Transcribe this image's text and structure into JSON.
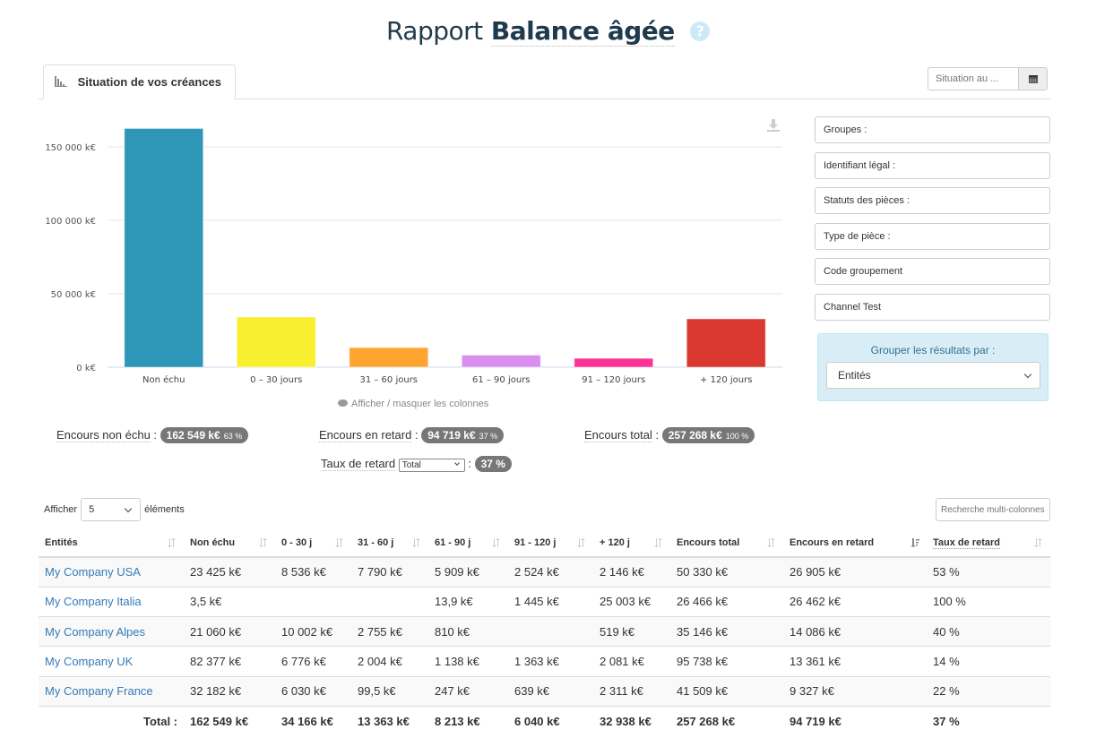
{
  "header": {
    "title_light": "Rapport",
    "title_bold": "Balance âgée",
    "help_icon": "question-circle-icon"
  },
  "tabs": [
    {
      "label": "Situation de vos créances",
      "icon": "bar-chart-icon",
      "active": true
    }
  ],
  "date_filter": {
    "placeholder": "Situation au ...",
    "icon": "calendar-icon"
  },
  "chart_data": {
    "type": "bar",
    "title": "",
    "xlabel": "",
    "ylabel": "",
    "categories": [
      "Non échu",
      "0 – 30 jours",
      "31 – 60 jours",
      "61 – 90 jours",
      "91 – 120 jours",
      "+ 120 jours"
    ],
    "values": [
      162549,
      34166,
      13363,
      8213,
      6040,
      32938
    ],
    "colors": [
      "#2e97b8",
      "#f7ef30",
      "#fda431",
      "#d88ff0",
      "#fd3296",
      "#da3830"
    ],
    "ylim": [
      0,
      165000
    ],
    "yticks": [
      0,
      50000,
      100000,
      150000
    ],
    "ytick_labels": [
      "0 k€",
      "50 000 k€",
      "100 000 k€",
      "150 000 k€"
    ],
    "grid": true,
    "unit": "k€"
  },
  "chart_footer": {
    "toggle_columns": "Afficher / masquer les colonnes",
    "icon": "eye-icon"
  },
  "download_icon": "download-icon",
  "filters": [
    {
      "label": "Groupes :"
    },
    {
      "label": "Identifiant légal :"
    },
    {
      "label": "Statuts des pièces :"
    },
    {
      "label": "Type de pièce :"
    },
    {
      "label": "Code groupement"
    },
    {
      "label": "Channel Test"
    }
  ],
  "group_by": {
    "label": "Grouper les résultats par :",
    "selected": "Entités"
  },
  "summary": {
    "non_echu": {
      "label": "Encours non échu",
      "value": "162 549 k€",
      "pct": "63 %"
    },
    "retard": {
      "label": "Encours en retard",
      "value": "94 719 k€",
      "pct": "37 %"
    },
    "total": {
      "label": "Encours total",
      "value": "257 268 k€",
      "pct": "100 %"
    },
    "taux": {
      "label": "Taux de retard",
      "select": "Total",
      "value": "37 %"
    }
  },
  "table_controls": {
    "show_label": "Afficher",
    "page_length": "5",
    "elements_label": "éléments",
    "search_placeholder": "Recherche multi-colonnes"
  },
  "table": {
    "columns": [
      "Entités",
      "Non échu",
      "0 - 30 j",
      "31 - 60 j",
      "61 - 90 j",
      "91 - 120 j",
      "+ 120 j",
      "Encours total",
      "Encours en retard",
      "Taux de retard"
    ],
    "sorted_column": "Encours en retard",
    "rows": [
      [
        "My Company USA",
        "23 425 k€",
        "8 536 k€",
        "7 790 k€",
        "5 909 k€",
        "2 524 k€",
        "2 146 k€",
        "50 330 k€",
        "26 905 k€",
        "53 %"
      ],
      [
        "My Company Italia",
        "3,5 k€",
        "",
        "",
        "13,9 k€",
        "1 445 k€",
        "25 003 k€",
        "26 466 k€",
        "26 462 k€",
        "100 %"
      ],
      [
        "My Company Alpes",
        "21 060 k€",
        "10 002 k€",
        "2 755 k€",
        "810 k€",
        "",
        "519 k€",
        "35 146 k€",
        "14 086 k€",
        "40 %"
      ],
      [
        "My Company UK",
        "82 377 k€",
        "6 776 k€",
        "2 004 k€",
        "1 138 k€",
        "1 363 k€",
        "2 081 k€",
        "95 738 k€",
        "13 361 k€",
        "14 %"
      ],
      [
        "My Company France",
        "32 182 k€",
        "6 030 k€",
        "99,5 k€",
        "247 k€",
        "639 k€",
        "2 311 k€",
        "41 509 k€",
        "9 327 k€",
        "22 %"
      ]
    ],
    "total": [
      "Total :",
      "162 549 k€",
      "34 166 k€",
      "13 363 k€",
      "8 213 k€",
      "6 040 k€",
      "32 938 k€",
      "257 268 k€",
      "94 719 k€",
      "37 %"
    ]
  }
}
